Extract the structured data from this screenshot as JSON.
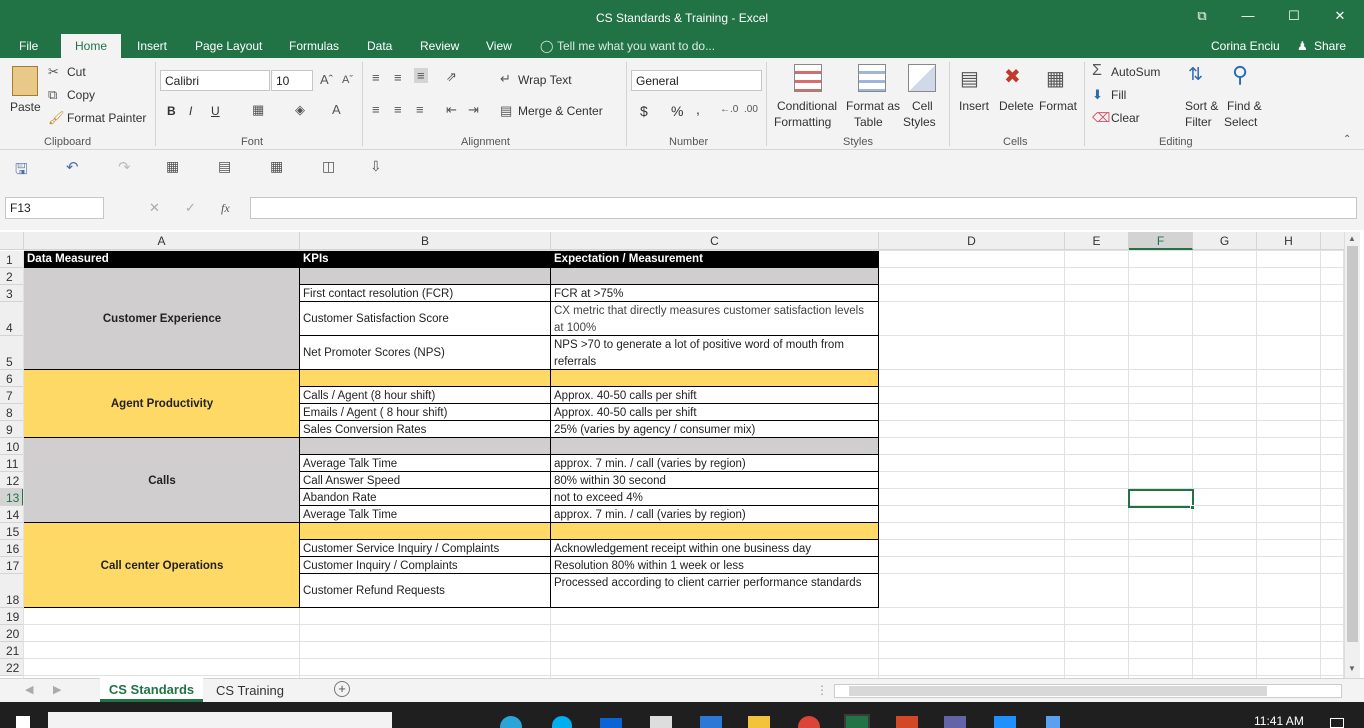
{
  "window": {
    "title": "CS Standards & Training - Excel",
    "restore_glyph": "⧉",
    "min_glyph": "—",
    "max_glyph": "☐",
    "close_glyph": "✕"
  },
  "menu": {
    "tabs": [
      "File",
      "Home",
      "Insert",
      "Page Layout",
      "Formulas",
      "Data",
      "Review",
      "View"
    ],
    "tell_me": "Tell me what you want to do...",
    "user": "Corina Enciu",
    "share": "Share"
  },
  "ribbon": {
    "clipboard": {
      "paste": "Paste",
      "cut": "Cut",
      "copy": "Copy",
      "format_painter": "Format Painter",
      "group": "Clipboard"
    },
    "font": {
      "name": "Calibri",
      "size": "10",
      "group": "Font",
      "bold": "B",
      "italic": "I",
      "underline": "U"
    },
    "alignment": {
      "wrap": "Wrap Text",
      "merge": "Merge & Center",
      "group": "Alignment"
    },
    "number": {
      "format": "General",
      "currency": "$",
      "percent": "%",
      "comma": ",",
      "group": "Number"
    },
    "styles": {
      "conditional": "Conditional",
      "conditional2": "Formatting",
      "format_table": "Format as",
      "format_table2": "Table",
      "cell_styles": "Cell",
      "cell_styles2": "Styles",
      "group": "Styles"
    },
    "cells": {
      "insert": "Insert",
      "delete": "Delete",
      "format": "Format",
      "group": "Cells"
    },
    "editing": {
      "autosum": "AutoSum",
      "fill": "Fill",
      "clear": "Clear",
      "sort": "Sort &",
      "sort2": "Filter",
      "find": "Find &",
      "find2": "Select",
      "group": "Editing"
    }
  },
  "formula_bar": {
    "name_box": "F13",
    "fx": "fx",
    "value": ""
  },
  "columns": [
    "A",
    "B",
    "C",
    "D",
    "E",
    "F",
    "G",
    "H"
  ],
  "rows": [
    "1",
    "2",
    "3",
    "4",
    "5",
    "6",
    "7",
    "8",
    "9",
    "10",
    "11",
    "12",
    "13",
    "14",
    "15",
    "16",
    "17",
    "18",
    "19",
    "20",
    "21",
    "22"
  ],
  "table": {
    "headers": {
      "a": "Data Measured",
      "b": "KPIs",
      "c": "Expectation / Measurement"
    },
    "categories": [
      "Customer Experience",
      "Agent Productivity",
      "Calls",
      "Call center Operations"
    ],
    "kpis": {
      "r3": "First contact resolution (FCR)",
      "r4": "Customer Satisfaction Score",
      "r5": "Net Promoter Scores (NPS)",
      "r7": "Calls / Agent (8 hour shift)",
      "r8": "Emails / Agent ( 8 hour shift)",
      "r9": "Sales Conversion Rates",
      "r11": "Average Talk Time",
      "r12": "Call Answer Speed",
      "r13": "Abandon Rate",
      "r14": "Average Talk Time",
      "r16": "Customer Service  Inquiry / Complaints",
      "r17": "Customer Inquiry / Complaints",
      "r18": "Customer Refund Requests"
    },
    "expectations": {
      "r3": " FCR at >75%",
      "r4": "CX metric that directly measures customer satisfaction levels at 100%",
      "r5": "NPS >70 to generate a lot of positive word of mouth from referrals",
      "r7": "Approx. 40-50 calls per shift",
      "r8": "Approx. 40-50 calls per shift",
      "r9": "25% (varies by agency / consumer mix)",
      "r11": "approx. 7 min. / call (varies by region)",
      "r12": "80% within 30 second",
      "r13": "not to exceed 4%",
      "r14": "approx. 7 min. / call (varies by region)",
      "r16": "Acknowledgement receipt within one business day",
      "r17": "Resolution 80% within 1 week or less",
      "r18": "Processed according to client carrier performance standards"
    }
  },
  "sheet_tabs": [
    "CS Standards",
    "CS Training"
  ],
  "taskbar": {
    "time": "11:41 AM"
  },
  "colors": {
    "excel_green": "#217346",
    "grey_band": "#d0cece",
    "yellow_band": "#ffd966"
  }
}
